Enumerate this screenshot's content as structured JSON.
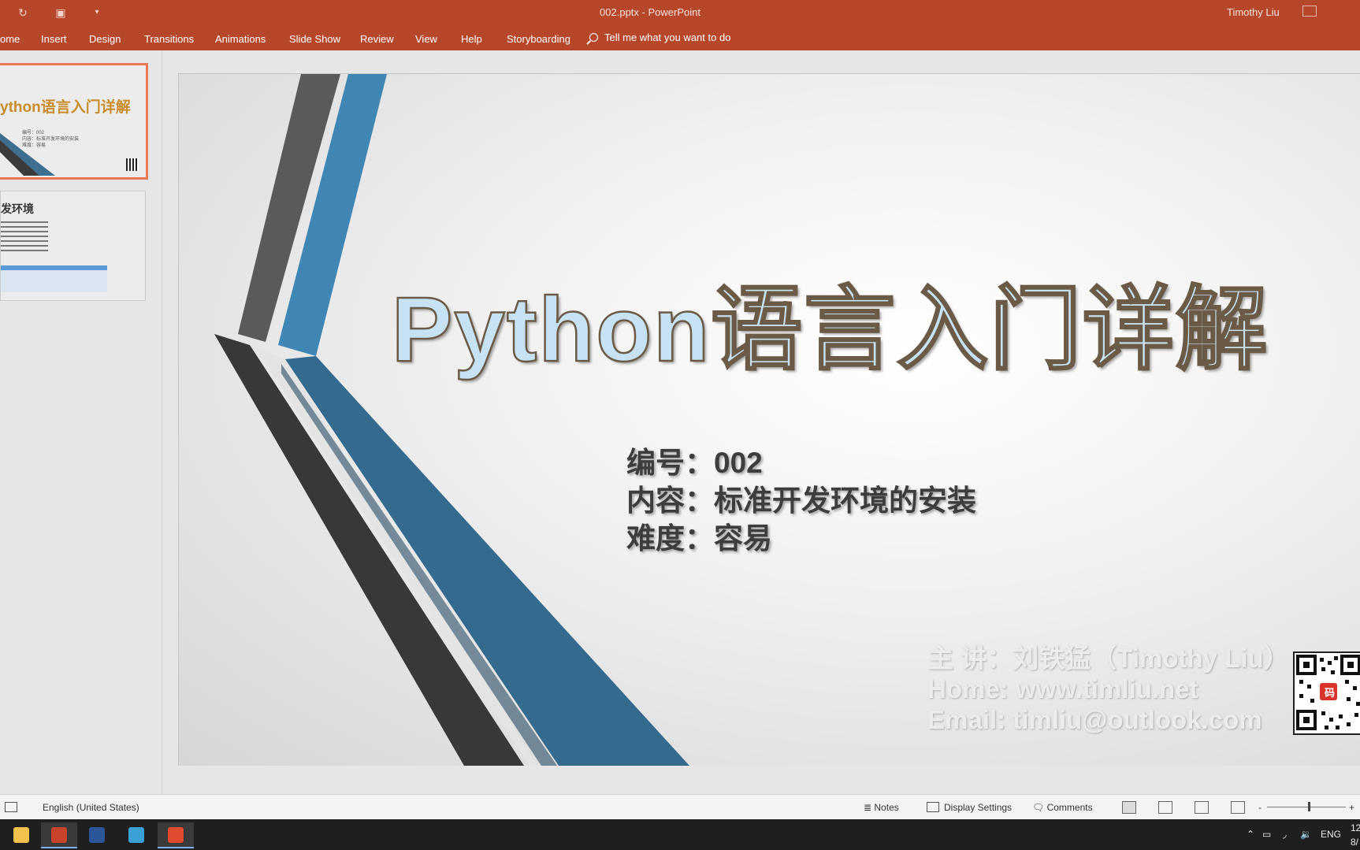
{
  "window": {
    "doc_title": "002.pptx  -  PowerPoint",
    "user": "Timothy Liu"
  },
  "ribbon": {
    "tabs": [
      "ome",
      "Insert",
      "Design",
      "Transitions",
      "Animations",
      "Slide Show",
      "Review",
      "View",
      "Help",
      "Storyboarding"
    ],
    "tell_me": "Tell me what you want to do"
  },
  "thumbnails": {
    "slide1_title": "ython语言入门详解",
    "slide1_meta": [
      "编号：002",
      "内容：标准开发环境的安装",
      "难度：容易"
    ],
    "slide2_title": "发环境"
  },
  "slide": {
    "title": "Python语言入门详解",
    "info": [
      "编号：002",
      "内容：标准开发环境的安装",
      "难度：容易"
    ],
    "credits": [
      "主  讲：刘铁猛（Timothy Liu）",
      "Home: www.timliu.net",
      "Email: timliu@outlook.com"
    ],
    "qr_label": "码",
    "colors": {
      "accent_blue": "#3f86b5",
      "dark_band": "#3b3b3b",
      "ribbon": "#b7472a"
    }
  },
  "status": {
    "language": "English (United States)",
    "notes": "Notes",
    "display_settings": "Display Settings",
    "comments": "Comments",
    "zoom_minus": "-",
    "zoom_plus": "+"
  },
  "taskbar": {
    "tray_lang": "ENG",
    "clock_line1": "12",
    "clock_line2": "8/"
  }
}
